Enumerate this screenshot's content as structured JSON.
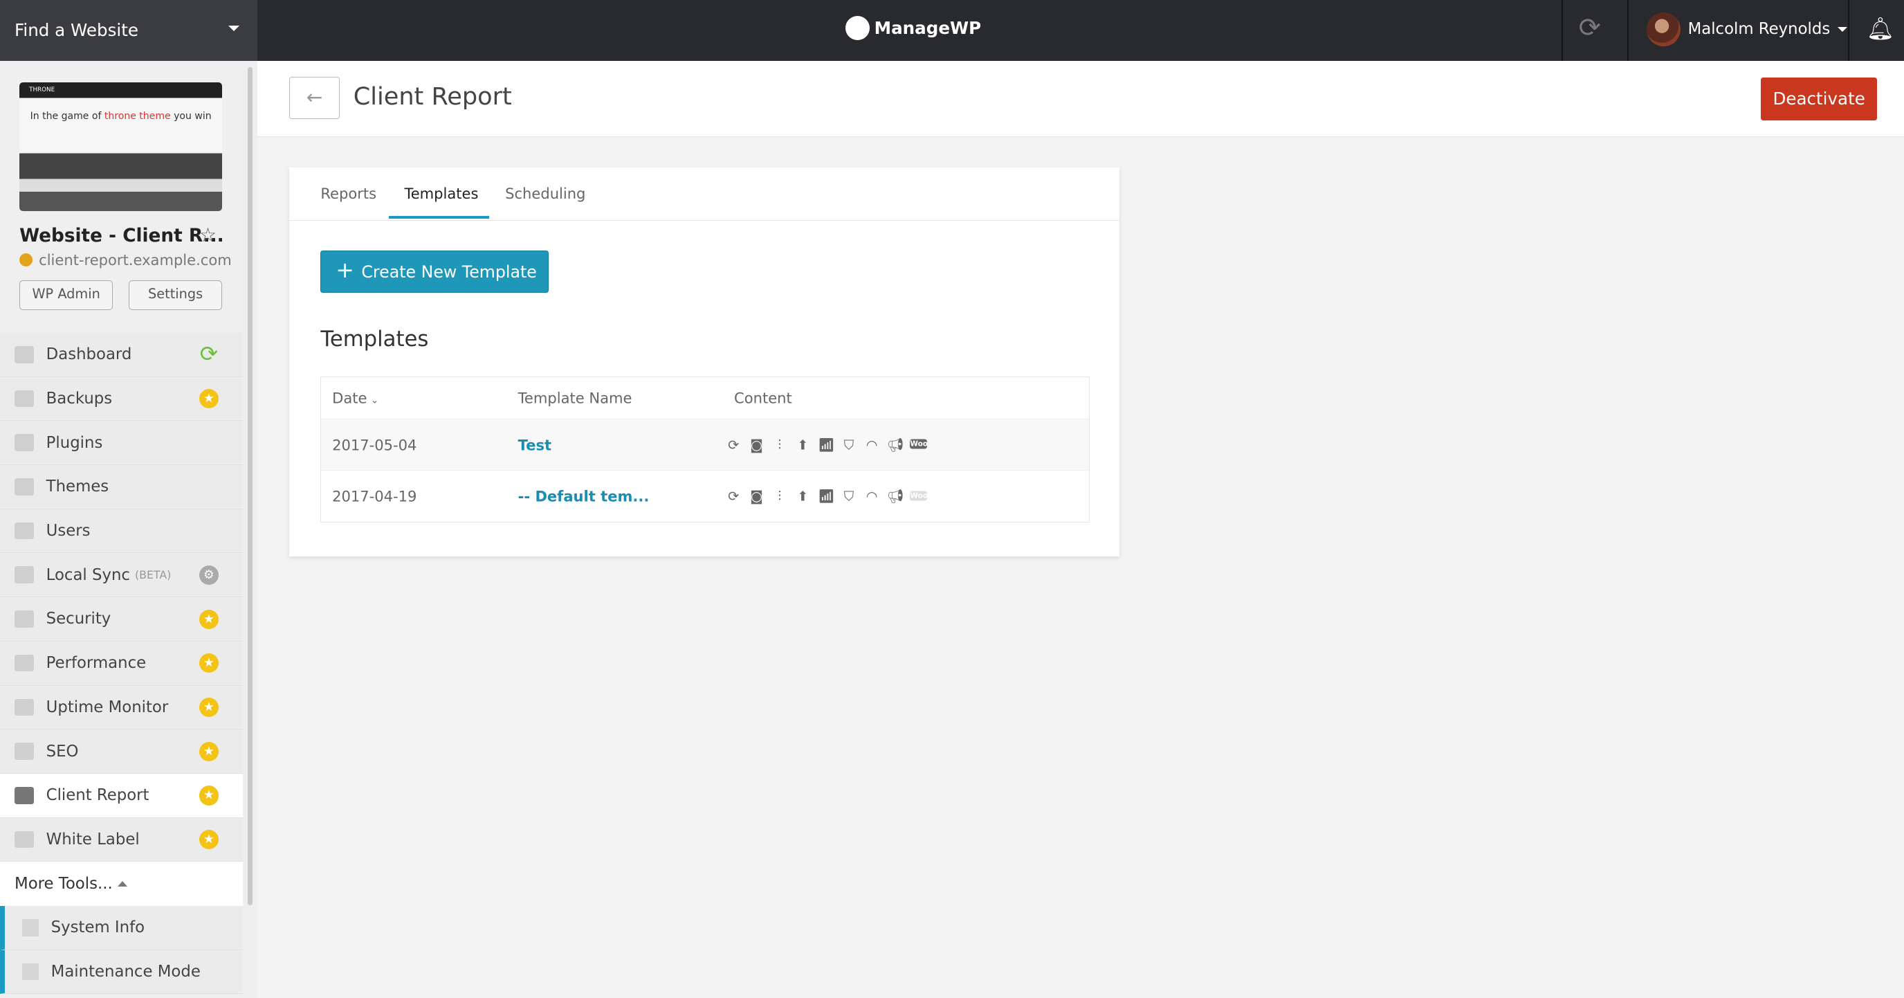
{
  "topbar": {
    "find_label": "Find a Website",
    "logo": "ManageWP",
    "user_name": "Malcolm Reynolds"
  },
  "site": {
    "thumb_brand": "THRONE",
    "thumb_headline_a": "In the game of ",
    "thumb_headline_b": "throne theme",
    "thumb_headline_c": " you win",
    "name": "Website - Client R...",
    "url": "client-report.example.com",
    "wp_admin": "WP Admin",
    "settings": "Settings"
  },
  "sidebar": {
    "items": [
      {
        "label": "Dashboard",
        "badge": "sync"
      },
      {
        "label": "Backups",
        "badge": "star"
      },
      {
        "label": "Plugins",
        "badge": ""
      },
      {
        "label": "Themes",
        "badge": ""
      },
      {
        "label": "Users",
        "badge": ""
      },
      {
        "label": "Local Sync",
        "extra": "(BETA)",
        "badge": "gear"
      },
      {
        "label": "Security",
        "badge": "star"
      },
      {
        "label": "Performance",
        "badge": "star"
      },
      {
        "label": "Uptime Monitor",
        "badge": "star"
      },
      {
        "label": "SEO",
        "badge": "star"
      },
      {
        "label": "Client Report",
        "badge": "star",
        "active": true
      },
      {
        "label": "White Label",
        "badge": "star"
      }
    ],
    "more_tools": "More Tools...",
    "sub_items": [
      {
        "label": "System Info"
      },
      {
        "label": "Maintenance Mode"
      }
    ]
  },
  "header": {
    "title": "Client Report",
    "deactivate": "Deactivate"
  },
  "tabs": [
    {
      "label": "Reports"
    },
    {
      "label": "Templates",
      "active": true
    },
    {
      "label": "Scheduling"
    }
  ],
  "create_button": "Create New Template",
  "section_title": "Templates",
  "table": {
    "headers": [
      "Date",
      "Template Name",
      "Content"
    ],
    "rows": [
      {
        "date": "2017-05-04",
        "name": "Test",
        "woo_enabled": true
      },
      {
        "date": "2017-04-19",
        "name": "-- Default tem...",
        "woo_enabled": false
      }
    ],
    "content_icons": [
      "sync-icon",
      "backup-icon",
      "plugins-icon",
      "uptime-icon",
      "analytics-icon",
      "security-icon",
      "performance-icon",
      "seo-icon",
      "woocommerce-icon"
    ]
  },
  "colors": {
    "accent": "#1f97b9",
    "danger": "#c9371e",
    "badge": "#f3c316",
    "topbar": "#292a2e"
  }
}
